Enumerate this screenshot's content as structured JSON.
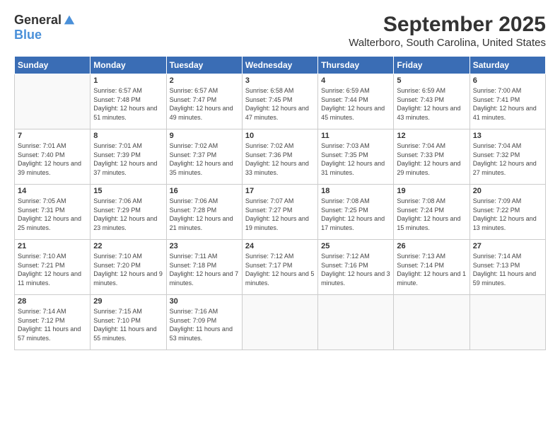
{
  "logo": {
    "general": "General",
    "blue": "Blue"
  },
  "title": "September 2025",
  "location": "Walterboro, South Carolina, United States",
  "days_of_week": [
    "Sunday",
    "Monday",
    "Tuesday",
    "Wednesday",
    "Thursday",
    "Friday",
    "Saturday"
  ],
  "weeks": [
    [
      {
        "day": "",
        "sunrise": "",
        "sunset": "",
        "daylight": ""
      },
      {
        "day": "1",
        "sunrise": "Sunrise: 6:57 AM",
        "sunset": "Sunset: 7:48 PM",
        "daylight": "Daylight: 12 hours and 51 minutes."
      },
      {
        "day": "2",
        "sunrise": "Sunrise: 6:57 AM",
        "sunset": "Sunset: 7:47 PM",
        "daylight": "Daylight: 12 hours and 49 minutes."
      },
      {
        "day": "3",
        "sunrise": "Sunrise: 6:58 AM",
        "sunset": "Sunset: 7:45 PM",
        "daylight": "Daylight: 12 hours and 47 minutes."
      },
      {
        "day": "4",
        "sunrise": "Sunrise: 6:59 AM",
        "sunset": "Sunset: 7:44 PM",
        "daylight": "Daylight: 12 hours and 45 minutes."
      },
      {
        "day": "5",
        "sunrise": "Sunrise: 6:59 AM",
        "sunset": "Sunset: 7:43 PM",
        "daylight": "Daylight: 12 hours and 43 minutes."
      },
      {
        "day": "6",
        "sunrise": "Sunrise: 7:00 AM",
        "sunset": "Sunset: 7:41 PM",
        "daylight": "Daylight: 12 hours and 41 minutes."
      }
    ],
    [
      {
        "day": "7",
        "sunrise": "Sunrise: 7:01 AM",
        "sunset": "Sunset: 7:40 PM",
        "daylight": "Daylight: 12 hours and 39 minutes."
      },
      {
        "day": "8",
        "sunrise": "Sunrise: 7:01 AM",
        "sunset": "Sunset: 7:39 PM",
        "daylight": "Daylight: 12 hours and 37 minutes."
      },
      {
        "day": "9",
        "sunrise": "Sunrise: 7:02 AM",
        "sunset": "Sunset: 7:37 PM",
        "daylight": "Daylight: 12 hours and 35 minutes."
      },
      {
        "day": "10",
        "sunrise": "Sunrise: 7:02 AM",
        "sunset": "Sunset: 7:36 PM",
        "daylight": "Daylight: 12 hours and 33 minutes."
      },
      {
        "day": "11",
        "sunrise": "Sunrise: 7:03 AM",
        "sunset": "Sunset: 7:35 PM",
        "daylight": "Daylight: 12 hours and 31 minutes."
      },
      {
        "day": "12",
        "sunrise": "Sunrise: 7:04 AM",
        "sunset": "Sunset: 7:33 PM",
        "daylight": "Daylight: 12 hours and 29 minutes."
      },
      {
        "day": "13",
        "sunrise": "Sunrise: 7:04 AM",
        "sunset": "Sunset: 7:32 PM",
        "daylight": "Daylight: 12 hours and 27 minutes."
      }
    ],
    [
      {
        "day": "14",
        "sunrise": "Sunrise: 7:05 AM",
        "sunset": "Sunset: 7:31 PM",
        "daylight": "Daylight: 12 hours and 25 minutes."
      },
      {
        "day": "15",
        "sunrise": "Sunrise: 7:06 AM",
        "sunset": "Sunset: 7:29 PM",
        "daylight": "Daylight: 12 hours and 23 minutes."
      },
      {
        "day": "16",
        "sunrise": "Sunrise: 7:06 AM",
        "sunset": "Sunset: 7:28 PM",
        "daylight": "Daylight: 12 hours and 21 minutes."
      },
      {
        "day": "17",
        "sunrise": "Sunrise: 7:07 AM",
        "sunset": "Sunset: 7:27 PM",
        "daylight": "Daylight: 12 hours and 19 minutes."
      },
      {
        "day": "18",
        "sunrise": "Sunrise: 7:08 AM",
        "sunset": "Sunset: 7:25 PM",
        "daylight": "Daylight: 12 hours and 17 minutes."
      },
      {
        "day": "19",
        "sunrise": "Sunrise: 7:08 AM",
        "sunset": "Sunset: 7:24 PM",
        "daylight": "Daylight: 12 hours and 15 minutes."
      },
      {
        "day": "20",
        "sunrise": "Sunrise: 7:09 AM",
        "sunset": "Sunset: 7:22 PM",
        "daylight": "Daylight: 12 hours and 13 minutes."
      }
    ],
    [
      {
        "day": "21",
        "sunrise": "Sunrise: 7:10 AM",
        "sunset": "Sunset: 7:21 PM",
        "daylight": "Daylight: 12 hours and 11 minutes."
      },
      {
        "day": "22",
        "sunrise": "Sunrise: 7:10 AM",
        "sunset": "Sunset: 7:20 PM",
        "daylight": "Daylight: 12 hours and 9 minutes."
      },
      {
        "day": "23",
        "sunrise": "Sunrise: 7:11 AM",
        "sunset": "Sunset: 7:18 PM",
        "daylight": "Daylight: 12 hours and 7 minutes."
      },
      {
        "day": "24",
        "sunrise": "Sunrise: 7:12 AM",
        "sunset": "Sunset: 7:17 PM",
        "daylight": "Daylight: 12 hours and 5 minutes."
      },
      {
        "day": "25",
        "sunrise": "Sunrise: 7:12 AM",
        "sunset": "Sunset: 7:16 PM",
        "daylight": "Daylight: 12 hours and 3 minutes."
      },
      {
        "day": "26",
        "sunrise": "Sunrise: 7:13 AM",
        "sunset": "Sunset: 7:14 PM",
        "daylight": "Daylight: 12 hours and 1 minute."
      },
      {
        "day": "27",
        "sunrise": "Sunrise: 7:14 AM",
        "sunset": "Sunset: 7:13 PM",
        "daylight": "Daylight: 11 hours and 59 minutes."
      }
    ],
    [
      {
        "day": "28",
        "sunrise": "Sunrise: 7:14 AM",
        "sunset": "Sunset: 7:12 PM",
        "daylight": "Daylight: 11 hours and 57 minutes."
      },
      {
        "day": "29",
        "sunrise": "Sunrise: 7:15 AM",
        "sunset": "Sunset: 7:10 PM",
        "daylight": "Daylight: 11 hours and 55 minutes."
      },
      {
        "day": "30",
        "sunrise": "Sunrise: 7:16 AM",
        "sunset": "Sunset: 7:09 PM",
        "daylight": "Daylight: 11 hours and 53 minutes."
      },
      {
        "day": "",
        "sunrise": "",
        "sunset": "",
        "daylight": ""
      },
      {
        "day": "",
        "sunrise": "",
        "sunset": "",
        "daylight": ""
      },
      {
        "day": "",
        "sunrise": "",
        "sunset": "",
        "daylight": ""
      },
      {
        "day": "",
        "sunrise": "",
        "sunset": "",
        "daylight": ""
      }
    ]
  ]
}
